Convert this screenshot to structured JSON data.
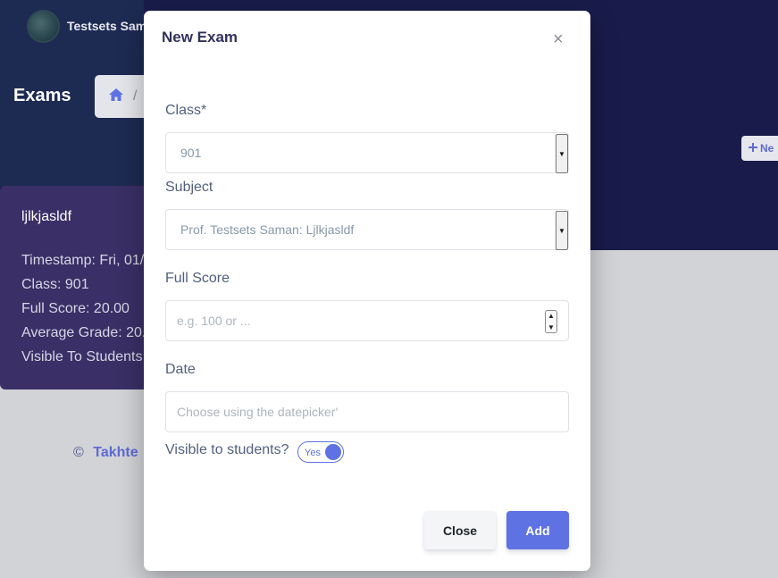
{
  "app": {
    "user_name": "Testsets Sam",
    "page_title": "Exams",
    "breadcrumb_separator": "/",
    "new_button_label": "Ne",
    "footer": {
      "copyright": "©",
      "brand": "Takhte"
    }
  },
  "exam_card": {
    "title": "ljlkjasldf",
    "lines": [
      "Timestamp: Fri, 01/",
      "Class: 901",
      "Full Score: 20.00",
      "Average Grade: 20.",
      "Visible To Students"
    ]
  },
  "modal": {
    "title": "New Exam",
    "close_icon": "×",
    "class_label": "Class*",
    "class_value": "901",
    "subject_label": "Subject",
    "subject_value": "Prof. Testsets Saman: Ljlkjasldf",
    "full_score_label": "Full Score",
    "full_score_placeholder": "e.g. 100 or ...",
    "date_label": "Date",
    "date_placeholder": "Choose using the datepicker'",
    "visible_label": "Visible to students?",
    "visible_toggle_text": "Yes",
    "close_button": "Close",
    "add_button": "Add"
  },
  "icons": {
    "home": "home-icon",
    "plus": "plus-icon",
    "caret": "caret-down-icon",
    "spin": "spinner-arrows-icon"
  },
  "colors": {
    "hero": "#191b4a",
    "accent": "#5e72e4",
    "card": "#3a2f66"
  }
}
